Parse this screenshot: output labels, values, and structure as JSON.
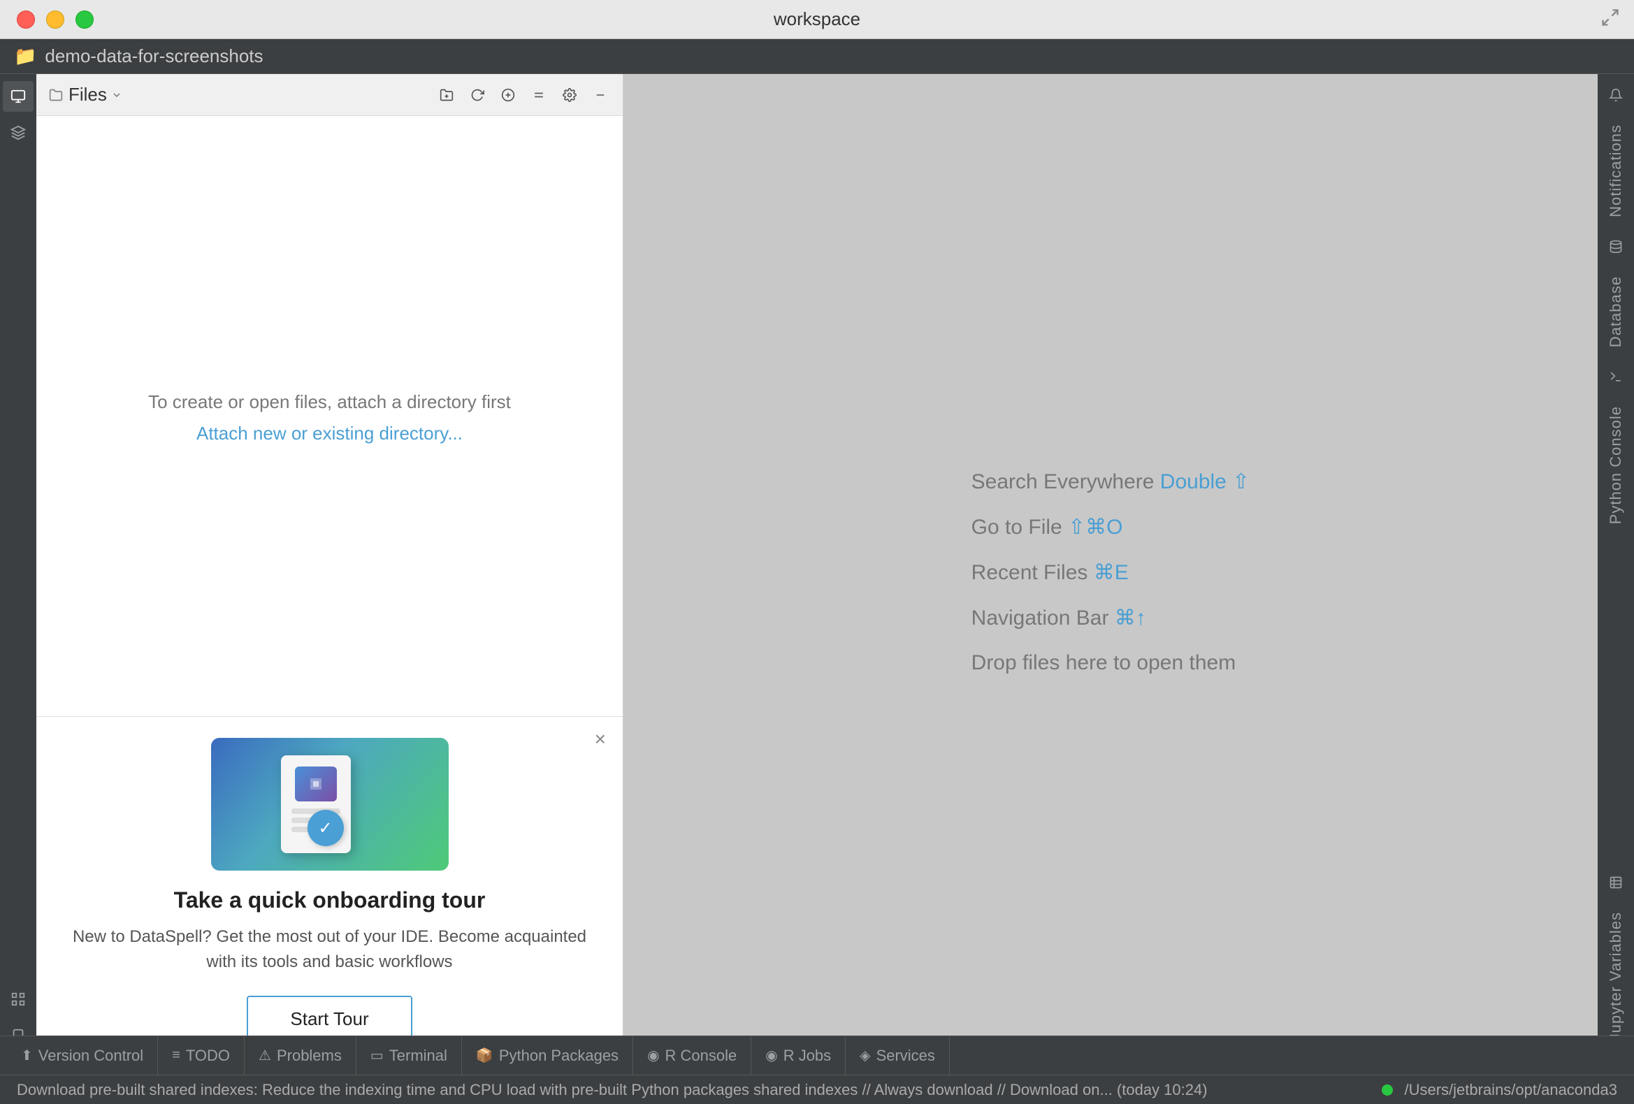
{
  "titleBar": {
    "title": "workspace",
    "trafficLights": [
      "red",
      "yellow",
      "green"
    ]
  },
  "breadcrumb": {
    "folderName": "demo-data-for-screenshots"
  },
  "sidebar": {
    "filesLabel": "Files",
    "toolbar": {
      "buttons": [
        "new-folder",
        "refresh",
        "add-root",
        "collapse-all",
        "settings",
        "close"
      ]
    },
    "emptyMessage": "To create or open files, attach a directory first",
    "attachLink": "Attach new or existing directory...",
    "onboarding": {
      "title": "Take a quick onboarding tour",
      "description": "New to DataSpell? Get the most out of your IDE. Become acquainted with its tools and basic workflows",
      "buttonLabel": "Start Tour"
    }
  },
  "editor": {
    "hints": [
      {
        "text": "Search Everywhere ",
        "shortcut": "Double ⇧",
        "shortcutColor": true
      },
      {
        "text": "Go to File ",
        "shortcut": "⇧⌘O",
        "shortcutColor": true
      },
      {
        "text": "Recent Files ",
        "shortcut": "⌘E",
        "shortcutColor": true
      },
      {
        "text": "Navigation Bar ",
        "shortcut": "⌘↑",
        "shortcutColor": true
      },
      {
        "text": "Drop files here to open them",
        "shortcut": "",
        "shortcutColor": false
      }
    ]
  },
  "rightPanel": {
    "items": [
      "Notifications",
      "Database",
      "Python Console",
      "Jupyter Variables"
    ]
  },
  "activityBar": {
    "items": [
      "Workspace",
      "Learn",
      "Structure",
      "Bookmarks"
    ]
  },
  "bottomTabs": [
    {
      "icon": "⬆",
      "label": "Version Control"
    },
    {
      "icon": "≡",
      "label": "TODO"
    },
    {
      "icon": "⚠",
      "label": "Problems"
    },
    {
      "icon": "▭",
      "label": "Terminal"
    },
    {
      "icon": "📦",
      "label": "Python Packages"
    },
    {
      "icon": "◉",
      "label": "R Console"
    },
    {
      "icon": "◉",
      "label": "R Jobs"
    },
    {
      "icon": "◈",
      "label": "Services"
    }
  ],
  "statusBar": {
    "message": "Download pre-built shared indexes: Reduce the indexing time and CPU load with pre-built Python packages shared indexes // Always download // Download on... (today 10:24)",
    "path": "/Users/jetbrains/opt/anaconda3"
  }
}
